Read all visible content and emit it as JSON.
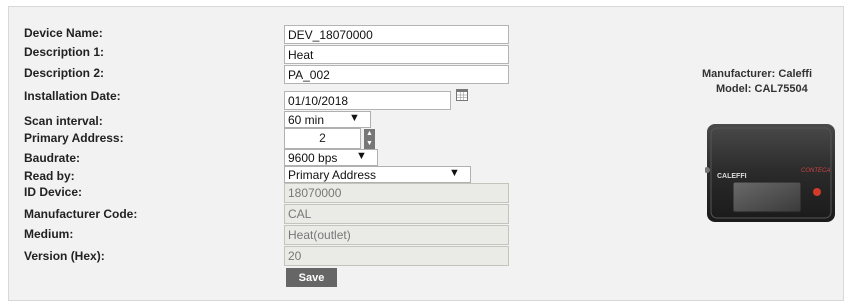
{
  "labels": {
    "device_name": "Device Name:",
    "description1": "Description 1:",
    "description2": "Description 2:",
    "installation_date": "Installation Date:",
    "scan_interval": "Scan interval:",
    "primary_address": "Primary Address:",
    "baudrate": "Baudrate:",
    "read_by": "Read by:",
    "id_device": "ID Device:",
    "manufacturer_code": "Manufacturer Code:",
    "medium": "Medium:",
    "version_hex": "Version (Hex):"
  },
  "values": {
    "device_name": "DEV_18070000",
    "description1": "Heat",
    "description2": "PA_002",
    "installation_date": "01/10/2018",
    "scan_interval": "60 min",
    "primary_address": "2",
    "baudrate": "9600 bps",
    "read_by": "Primary Address",
    "id_device": "18070000",
    "manufacturer_code": "CAL",
    "medium": "Heat(outlet)",
    "version_hex": "20"
  },
  "buttons": {
    "save": "Save"
  },
  "device_info": {
    "manufacturer": "Manufacturer: Caleffi",
    "model": "Model: CAL75504"
  },
  "image_text": {
    "brand": "CALEFFI",
    "product": "CONTECA"
  },
  "icons": {
    "calendar": "calendar-icon",
    "spin_up": "spin-up-icon",
    "spin_down": "spin-down-icon",
    "dropdown": "dropdown-arrow-icon"
  },
  "colors": {
    "panel_bg": "#f2f2f2",
    "button_bg": "#666666",
    "readonly_bg": "#eaeae6"
  }
}
